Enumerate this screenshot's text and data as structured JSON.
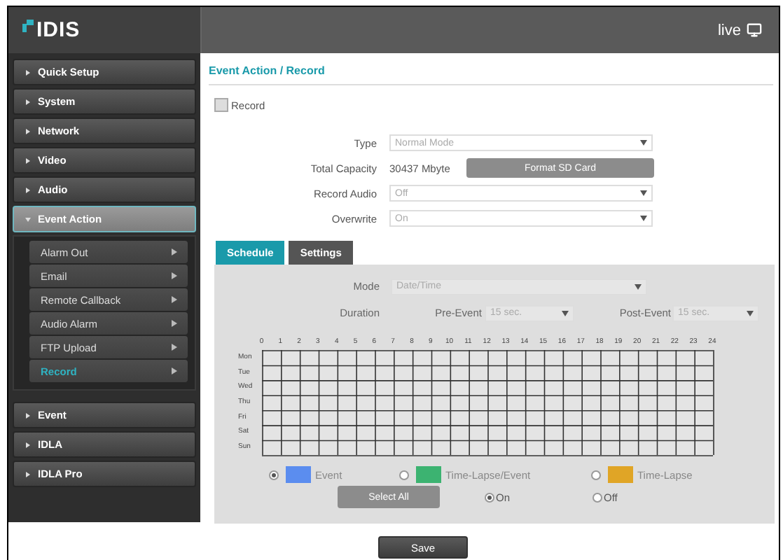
{
  "header": {
    "logo": "IDIS",
    "live": "live"
  },
  "sidebar": {
    "items": [
      {
        "label": "Quick Setup",
        "expanded": false
      },
      {
        "label": "System",
        "expanded": false
      },
      {
        "label": "Network",
        "expanded": false
      },
      {
        "label": "Video",
        "expanded": false
      },
      {
        "label": "Audio",
        "expanded": false
      },
      {
        "label": "Event Action",
        "expanded": true,
        "children": [
          {
            "label": "Alarm Out",
            "selected": false
          },
          {
            "label": "Email",
            "selected": false
          },
          {
            "label": "Remote Callback",
            "selected": false
          },
          {
            "label": "Audio Alarm",
            "selected": false
          },
          {
            "label": "FTP Upload",
            "selected": false
          },
          {
            "label": "Record",
            "selected": true
          }
        ]
      },
      {
        "label": "Event",
        "expanded": false
      },
      {
        "label": "IDLA",
        "expanded": false
      },
      {
        "label": "IDLA Pro",
        "expanded": false
      }
    ]
  },
  "title": "Event Action / Record",
  "record": {
    "label": "Record",
    "checked": false
  },
  "fields": [
    {
      "kind": "select",
      "label": "Type",
      "value": "Normal Mode"
    },
    {
      "kind": "capacity",
      "label": "Total Capacity",
      "value": "30437 Mbyte",
      "button": "Format SD Card"
    },
    {
      "kind": "select",
      "label": "Record Audio",
      "value": "Off"
    },
    {
      "kind": "select",
      "label": "Overwrite",
      "value": "On"
    }
  ],
  "tabs": [
    {
      "label": "Schedule",
      "selected": true
    },
    {
      "label": "Settings",
      "selected": false
    }
  ],
  "schedule": {
    "mode_label": "Mode",
    "mode_value": "Date/Time",
    "duration_label": "Duration",
    "pre_label": "Pre-Event",
    "pre_value": "15 sec.",
    "post_label": "Post-Event",
    "post_value": "15 sec.",
    "hours": [
      "0",
      "1",
      "2",
      "3",
      "4",
      "5",
      "6",
      "7",
      "8",
      "9",
      "10",
      "11",
      "12",
      "13",
      "14",
      "15",
      "16",
      "17",
      "18",
      "19",
      "20",
      "21",
      "22",
      "23",
      "24"
    ],
    "days": [
      "Mon",
      "Tue",
      "Wed",
      "Thu",
      "Fri",
      "Sat",
      "Sun"
    ],
    "legend": [
      {
        "label": "Event",
        "color": "#5b8def",
        "selected": true
      },
      {
        "label": "Time-Lapse/Event",
        "color": "#3cb371",
        "selected": false
      },
      {
        "label": "Time-Lapse",
        "color": "#e0a526",
        "selected": false
      }
    ],
    "select_all": "Select All",
    "toggles": [
      {
        "label": "On",
        "selected": true
      },
      {
        "label": "Off",
        "selected": false
      }
    ]
  },
  "save": "Save"
}
